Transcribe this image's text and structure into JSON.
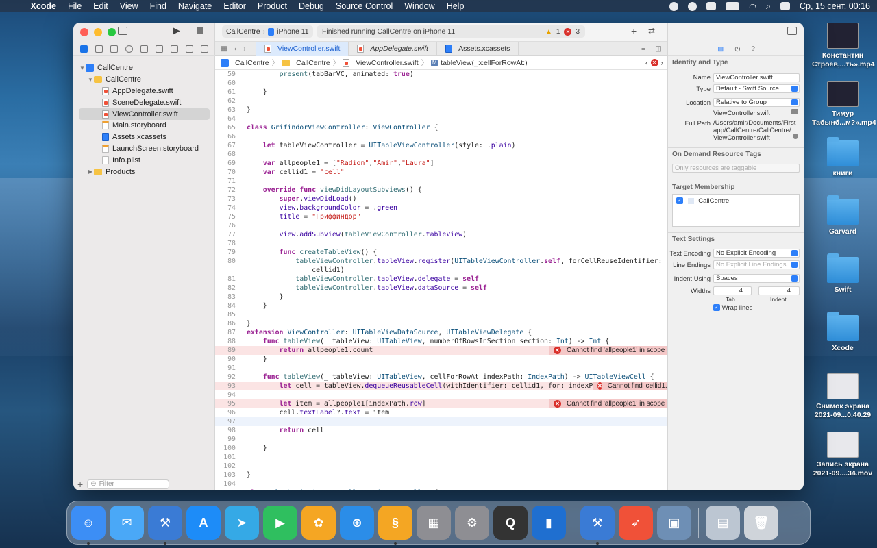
{
  "menubar": {
    "app": "Xcode",
    "items": [
      "File",
      "Edit",
      "View",
      "Find",
      "Navigate",
      "Editor",
      "Product",
      "Debug",
      "Source Control",
      "Window",
      "Help"
    ],
    "datetime": "Ср, 15 сент.  00:16"
  },
  "desktop": [
    {
      "label": "Константин Строев,...ть».mp4",
      "kind": "video"
    },
    {
      "label": "Тимур Табынб...м?».mp4",
      "kind": "video"
    },
    {
      "label": "книги",
      "kind": "folder"
    },
    {
      "label": "Garvard",
      "kind": "folder"
    },
    {
      "label": "Swift",
      "kind": "folder"
    },
    {
      "label": "Xcode",
      "kind": "folder"
    },
    {
      "label": "Снимок экрана 2021-09...0.40.29",
      "kind": "image"
    },
    {
      "label": "Запись экрана 2021-09....34.mov",
      "kind": "video"
    }
  ],
  "toolbar": {
    "scheme": "CallCentre",
    "device": "iPhone 11",
    "status": "Finished running CallCentre on iPhone 11",
    "warnings": "1",
    "errors": "3"
  },
  "tabs": [
    {
      "label": "ViewController.swift",
      "active": true
    },
    {
      "label": "AppDelegate.swift",
      "italic": true
    },
    {
      "label": "Assets.xcassets"
    }
  ],
  "jumpbar": [
    "CallCentre",
    "CallCentre",
    "ViewController.swift",
    "tableView(_:cellForRowAt:)"
  ],
  "navigator": {
    "items": [
      {
        "label": "CallCentre",
        "kind": "proj",
        "indent": 0,
        "tri": "▼"
      },
      {
        "label": "CallCentre",
        "kind": "fold",
        "indent": 1,
        "tri": "▼"
      },
      {
        "label": "AppDelegate.swift",
        "kind": "swift",
        "indent": 2
      },
      {
        "label": "SceneDelegate.swift",
        "kind": "swift",
        "indent": 2
      },
      {
        "label": "ViewController.swift",
        "kind": "swift",
        "indent": 2,
        "selected": true
      },
      {
        "label": "Main.storyboard",
        "kind": "sb",
        "indent": 2
      },
      {
        "label": "Assets.xcassets",
        "kind": "asset",
        "indent": 2
      },
      {
        "label": "LaunchScreen.storyboard",
        "kind": "sb",
        "indent": 2
      },
      {
        "label": "Info.plist",
        "kind": "plain",
        "indent": 2
      },
      {
        "label": "Products",
        "kind": "fold",
        "indent": 1,
        "tri": "▶"
      }
    ],
    "filter_placeholder": "Filter"
  },
  "code": [
    {
      "n": "59",
      "t": "        <span class='fn'>present</span>(tabBarVC, animated: <span class='kw'>true</span>)"
    },
    {
      "n": "60",
      "t": ""
    },
    {
      "n": "61",
      "t": "    }"
    },
    {
      "n": "62",
      "t": ""
    },
    {
      "n": "63",
      "t": "}"
    },
    {
      "n": "64",
      "t": ""
    },
    {
      "n": "65",
      "t": "<span class='kw'>class</span> <span class='ty'>GrifindorViewController</span>: <span class='ty'>ViewController</span> {"
    },
    {
      "n": "66",
      "t": ""
    },
    {
      "n": "67",
      "t": "    <span class='kw'>let</span> tableViewController = <span class='ty'>UITableViewController</span>(style: .<span class='pr'>plain</span>)"
    },
    {
      "n": "68",
      "t": ""
    },
    {
      "n": "69",
      "t": "    <span class='kw'>var</span> allpeople1 = [<span class='st'>\"Radion\"</span>,<span class='st'>\"Amir\"</span>,<span class='st'>\"Laura\"</span>]"
    },
    {
      "n": "70",
      "t": "    <span class='kw'>var</span> cellid1 = <span class='st'>\"cell\"</span>"
    },
    {
      "n": "71",
      "t": ""
    },
    {
      "n": "72",
      "t": "    <span class='kw'>override func</span> <span class='fn'>viewDidLayoutSubviews</span>() {"
    },
    {
      "n": "73",
      "t": "        <span class='kw'>super</span>.<span class='pr'>viewDidLoad</span>()"
    },
    {
      "n": "74",
      "t": "        <span class='pr'>view</span>.<span class='pr'>backgroundColor</span> = .<span class='pr'>green</span>"
    },
    {
      "n": "75",
      "t": "        <span class='pr'>title</span> = <span class='st'>\"Гриффиндор\"</span>"
    },
    {
      "n": "76",
      "t": ""
    },
    {
      "n": "77",
      "t": "        <span class='pr'>view</span>.<span class='pr'>addSubview</span>(<span class='fn'>tableViewController</span>.<span class='pr'>tableView</span>)"
    },
    {
      "n": "78",
      "t": ""
    },
    {
      "n": "79",
      "t": "        <span class='kw'>func</span> <span class='fn'>createTableView</span>() {"
    },
    {
      "n": "80",
      "t": "            <span class='fn'>tableViewController</span>.<span class='pr'>tableView</span>.<span class='pr'>register</span>(<span class='ty'>UITableViewController</span>.<span class='kw'>self</span>, forCellReuseIdentifier:"
    },
    {
      "n": "",
      "t": "                cellid1)"
    },
    {
      "n": "81",
      "t": "            <span class='fn'>tableViewController</span>.<span class='pr'>tableView</span>.<span class='pr'>delegate</span> = <span class='kw'>self</span>"
    },
    {
      "n": "82",
      "t": "            <span class='fn'>tableViewController</span>.<span class='pr'>tableView</span>.<span class='pr'>dataSource</span> = <span class='kw'>self</span>"
    },
    {
      "n": "83",
      "t": "        }"
    },
    {
      "n": "84",
      "t": "    }"
    },
    {
      "n": "85",
      "t": ""
    },
    {
      "n": "86",
      "t": "}"
    },
    {
      "n": "87",
      "t": "<span class='kw'>extension</span> <span class='ty'>ViewController</span>: <span class='ty'>UITableViewDataSource</span>, <span class='ty'>UITableViewDelegate</span> {"
    },
    {
      "n": "88",
      "t": "    <span class='kw'>func</span> <span class='fn'>tableView</span>(_ tableView: <span class='ty'>UITableView</span>, numberOfRowsInSection section: <span class='ty'>Int</span>) -> <span class='ty'>Int</span> {"
    },
    {
      "n": "89",
      "t": "        <span class='kw'>return</span> allpeople1.count",
      "err": "Cannot find 'allpeople1' in scope",
      "errleft": false
    },
    {
      "n": "90",
      "t": "    }"
    },
    {
      "n": "91",
      "t": ""
    },
    {
      "n": "92",
      "t": "    <span class='kw'>func</span> <span class='fn'>tableView</span>(_ tableView: <span class='ty'>UITableView</span>, cellForRowAt indexPath: <span class='ty'>IndexPath</span>) -> <span class='ty'>UITableViewCell</span> {"
    },
    {
      "n": "93",
      "t": "        <span class='kw'>let</span> cell = tableView.<span class='pr'>dequeueReusableCell</span>(withIdentifier: cellid1, for: indexPath)",
      "err": "Cannot find 'cellid1..."
    },
    {
      "n": "94",
      "t": ""
    },
    {
      "n": "95",
      "t": "        <span class='kw'>let</span> item = allpeople1[indexPath.<span class='pr'>row</span>]",
      "err": "Cannot find 'allpeople1' in scope"
    },
    {
      "n": "96",
      "t": "        cell.<span class='pr'>textLabel</span>?.<span class='pr'>text</span> = item"
    },
    {
      "n": "97",
      "t": "        ",
      "cur": true
    },
    {
      "n": "98",
      "t": "        <span class='kw'>return</span> cell"
    },
    {
      "n": "99",
      "t": ""
    },
    {
      "n": "100",
      "t": "    }"
    },
    {
      "n": "101",
      "t": ""
    },
    {
      "n": "102",
      "t": ""
    },
    {
      "n": "103",
      "t": "}"
    },
    {
      "n": "104",
      "t": ""
    },
    {
      "n": "105",
      "t": "<span class='kw'>class</span> <span class='ty'>SlytherinViewController</span>: <span class='ty'>ViewController</span> {"
    }
  ],
  "inspector": {
    "identity_title": "Identity and Type",
    "name_label": "Name",
    "name": "ViewController.swift",
    "type_label": "Type",
    "type": "Default - Swift Source",
    "location_label": "Location",
    "location": "Relative to Group",
    "location_file": "ViewController.swift",
    "fullpath_label": "Full Path",
    "fullpath": "/Users/amir/Documents/First app/CallCentre/CallCentre/ ViewController.swift",
    "ondemand_title": "On Demand Resource Tags",
    "ondemand_placeholder": "Only resources are taggable",
    "target_title": "Target Membership",
    "target": "CallCentre",
    "text_title": "Text Settings",
    "encoding_label": "Text Encoding",
    "encoding": "No Explicit Encoding",
    "lineend_label": "Line Endings",
    "lineend": "No Explicit Line Endings",
    "indent_label": "Indent Using",
    "indent": "Spaces",
    "widths_label": "Widths",
    "tab_width": "4",
    "indent_width": "4",
    "tab_label": "Tab",
    "indent_sub": "Indent",
    "wrap_label": "Wrap lines"
  },
  "dock": [
    {
      "name": "Finder",
      "color": "#3c8ef5",
      "glyph": "☺"
    },
    {
      "name": "Mail",
      "color": "#4aa8f7",
      "glyph": "✉"
    },
    {
      "name": "Xcode",
      "color": "#3a7bd5",
      "glyph": "⚒"
    },
    {
      "name": "App Store",
      "color": "#1d8cf8",
      "glyph": "A"
    },
    {
      "name": "Telegram",
      "color": "#35a9e6",
      "glyph": "➤"
    },
    {
      "name": "Facetime",
      "color": "#2fbf5f",
      "glyph": "▶"
    },
    {
      "name": "Photos",
      "color": "#f5a623",
      "glyph": "✿"
    },
    {
      "name": "Safari",
      "color": "#2b8de8",
      "glyph": "⊕"
    },
    {
      "name": "Scrivener",
      "color": "#f4a623",
      "glyph": "§"
    },
    {
      "name": "Launchpad",
      "color": "#8e8e93",
      "glyph": "▦"
    },
    {
      "name": "System Preferences",
      "color": "#8e8e93",
      "glyph": "⚙"
    },
    {
      "name": "QuickTime",
      "color": "#333",
      "glyph": "Q"
    },
    {
      "name": "Trello",
      "color": "#1f6fd0",
      "glyph": "▮"
    },
    {
      "name": "Xcode",
      "color": "#3a7bd5",
      "glyph": "⚒"
    },
    {
      "name": "Swift Playgrounds",
      "color": "#f05138",
      "glyph": "➶"
    },
    {
      "name": "Preview",
      "color": "#6e8fb5",
      "glyph": "▣"
    },
    {
      "name": "Downloads",
      "color": "#bcc6d2",
      "glyph": "▤"
    },
    {
      "name": "Trash",
      "color": "#cfd4da",
      "glyph": "🗑"
    }
  ]
}
